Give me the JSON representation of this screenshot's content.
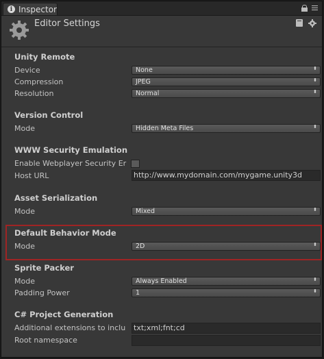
{
  "tab": {
    "label": "Inspector",
    "icon": "info-icon"
  },
  "header": {
    "title": "Editor Settings",
    "icon": "gear-icon"
  },
  "unity_remote": {
    "title": "Unity Remote",
    "device_label": "Device",
    "device_value": "None",
    "compression_label": "Compression",
    "compression_value": "JPEG",
    "resolution_label": "Resolution",
    "resolution_value": "Normal"
  },
  "version_control": {
    "title": "Version Control",
    "mode_label": "Mode",
    "mode_value": "Hidden Meta Files"
  },
  "www_security": {
    "title": "WWW Security Emulation",
    "enable_label": "Enable Webplayer Security Er",
    "enable_checked": false,
    "host_label": "Host URL",
    "host_value": "http://www.mydomain.com/mygame.unity3d"
  },
  "asset_serialization": {
    "title": "Asset Serialization",
    "mode_label": "Mode",
    "mode_value": "Mixed"
  },
  "default_behavior": {
    "title": "Default Behavior Mode",
    "mode_label": "Mode",
    "mode_value": "2D",
    "highlight_color": "#a02424"
  },
  "sprite_packer": {
    "title": "Sprite Packer",
    "mode_label": "Mode",
    "mode_value": "Always Enabled",
    "padding_label": "Padding Power",
    "padding_value": "1"
  },
  "csharp_project": {
    "title": "C# Project Generation",
    "extensions_label": "Additional extensions to inclu",
    "extensions_value": "txt;xml;fnt;cd",
    "namespace_label": "Root namespace",
    "namespace_value": ""
  },
  "dropdown_arrow": "⬍"
}
